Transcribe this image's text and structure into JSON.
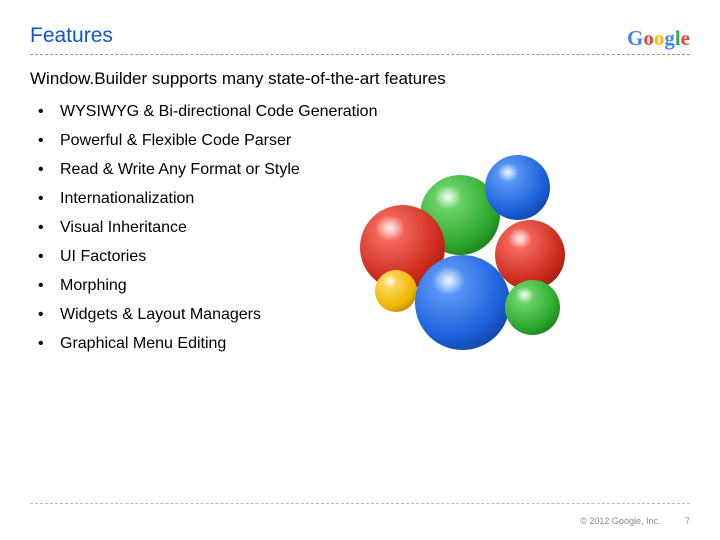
{
  "header": {
    "title": "Features",
    "logo_text": {
      "g1": "G",
      "o1": "o",
      "o2": "o",
      "g2": "g",
      "l": "l",
      "e": "e"
    }
  },
  "subtitle": "Window.Builder supports many state-of-the-art features",
  "features": {
    "item0": "WYSIWYG & Bi-directional Code Generation",
    "item1": "Powerful & Flexible Code Parser",
    "item2": "Read & Write Any Format or Style",
    "item3": "Internationalization",
    "item4": "Visual Inheritance",
    "item5": "UI Factories",
    "item6": "Morphing",
    "item7": "Widgets & Layout Managers",
    "item8": "Graphical Menu Editing"
  },
  "footer": {
    "copyright": "© 2012 Google, Inc.",
    "page": "7"
  }
}
